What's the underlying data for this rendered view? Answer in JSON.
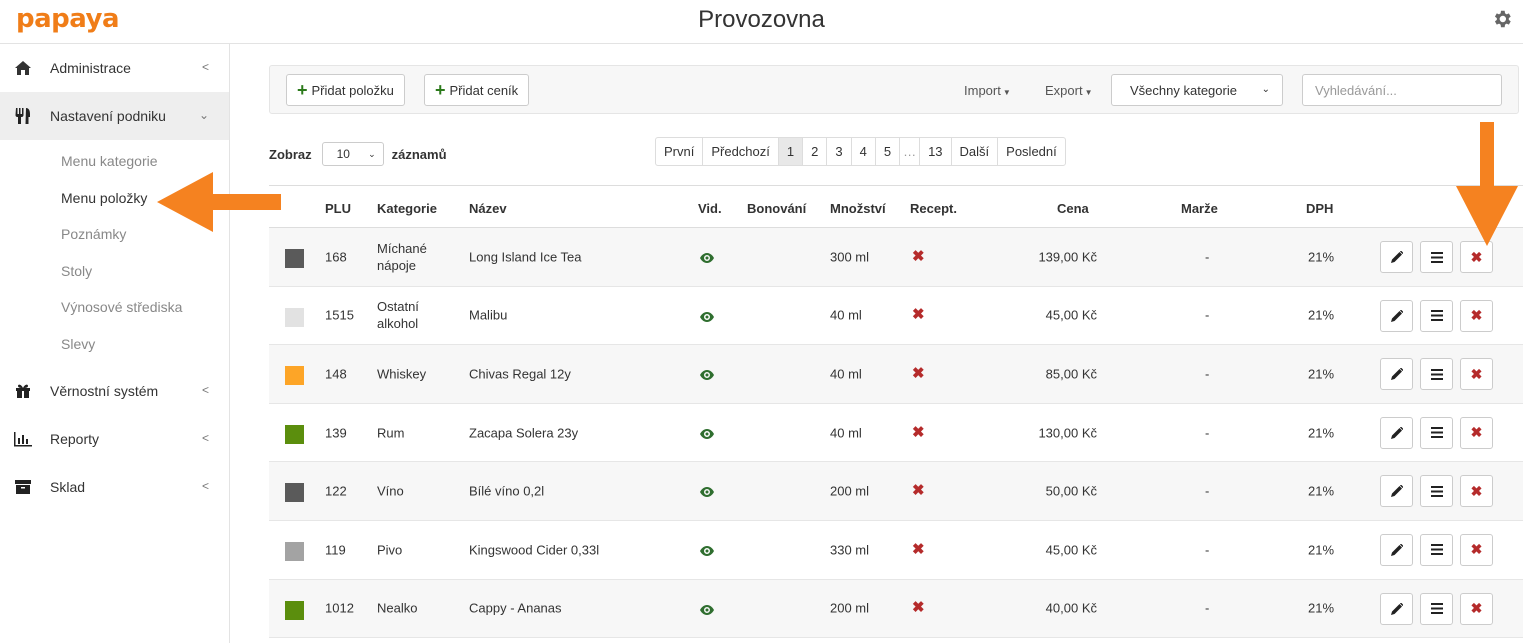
{
  "app": {
    "logo": "papaya",
    "title": "Provozovna"
  },
  "sidebar": {
    "items": [
      {
        "label": "Administrace",
        "icon": "home-icon"
      },
      {
        "label": "Nastavení podniku",
        "icon": "utensils-icon"
      },
      {
        "label": "Věrnostní systém",
        "icon": "gift-icon"
      },
      {
        "label": "Reporty",
        "icon": "bar-chart-icon"
      },
      {
        "label": "Sklad",
        "icon": "archive-icon"
      }
    ],
    "submenu": [
      "Menu kategorie",
      "Menu položky",
      "Poznámky",
      "Stoly",
      "Výnosové střediska",
      "Slevy"
    ]
  },
  "toolbar": {
    "add_item": "Přidat položku",
    "add_pricelist": "Přidat ceník",
    "import": "Import",
    "export": "Export",
    "category_select": "Všechny kategorie",
    "search_placeholder": "Vyhledávání..."
  },
  "length": {
    "prefix": "Zobraz",
    "value": "10",
    "suffix": "záznamů"
  },
  "pagination": [
    "První",
    "Předchozí",
    "1",
    "2",
    "3",
    "4",
    "5",
    "…",
    "13",
    "Další",
    "Poslední"
  ],
  "table": {
    "headers": {
      "plu": "PLU",
      "category": "Kategorie",
      "name": "Název",
      "visible": "Vid.",
      "bonovani": "Bonování",
      "quantity": "Množství",
      "recept": "Recept.",
      "price": "Cena",
      "margin": "Marže",
      "vat": "DPH"
    },
    "rows": [
      {
        "color": "#5a5a5a",
        "plu": "168",
        "cat1": "Míchané",
        "cat2": "nápoje",
        "name": "Long Island Ice Tea",
        "qty": "300 ml",
        "price": "139,00 Kč",
        "margin": "-",
        "vat": "21%"
      },
      {
        "color": "#e2e2e2",
        "plu": "1515",
        "cat1": "Ostatní",
        "cat2": "alkohol",
        "name": "Malibu",
        "qty": "40 ml",
        "price": "45,00 Kč",
        "margin": "-",
        "vat": "21%"
      },
      {
        "color": "#fda527",
        "plu": "148",
        "cat1": "Whiskey",
        "cat2": "",
        "name": "Chivas Regal 12y",
        "qty": "40 ml",
        "price": "85,00 Kč",
        "margin": "-",
        "vat": "21%"
      },
      {
        "color": "#5b8e0d",
        "plu": "139",
        "cat1": "Rum",
        "cat2": "",
        "name": "Zacapa Solera 23y",
        "qty": "40 ml",
        "price": "130,00 Kč",
        "margin": "-",
        "vat": "21%"
      },
      {
        "color": "#5a5a5a",
        "plu": "122",
        "cat1": "Víno",
        "cat2": "",
        "name": "Bílé víno 0,2l",
        "qty": "200 ml",
        "price": "50,00 Kč",
        "margin": "-",
        "vat": "21%"
      },
      {
        "color": "#a3a3a3",
        "plu": "119",
        "cat1": "Pivo",
        "cat2": "",
        "name": "Kingswood Cider 0,33l",
        "qty": "330 ml",
        "price": "45,00 Kč",
        "margin": "-",
        "vat": "21%"
      },
      {
        "color": "#5b8e0d",
        "plu": "1012",
        "cat1": "Nealko",
        "cat2": "",
        "name": "Cappy - Ananas",
        "qty": "200 ml",
        "price": "40,00 Kč",
        "margin": "-",
        "vat": "21%"
      }
    ]
  },
  "colors": {
    "brand": "#f07d18",
    "annotation_arrow": "#f58220",
    "add_plus": "#2c7a1b",
    "delete": "#b52b2b",
    "eye": "#2f6e2f"
  }
}
